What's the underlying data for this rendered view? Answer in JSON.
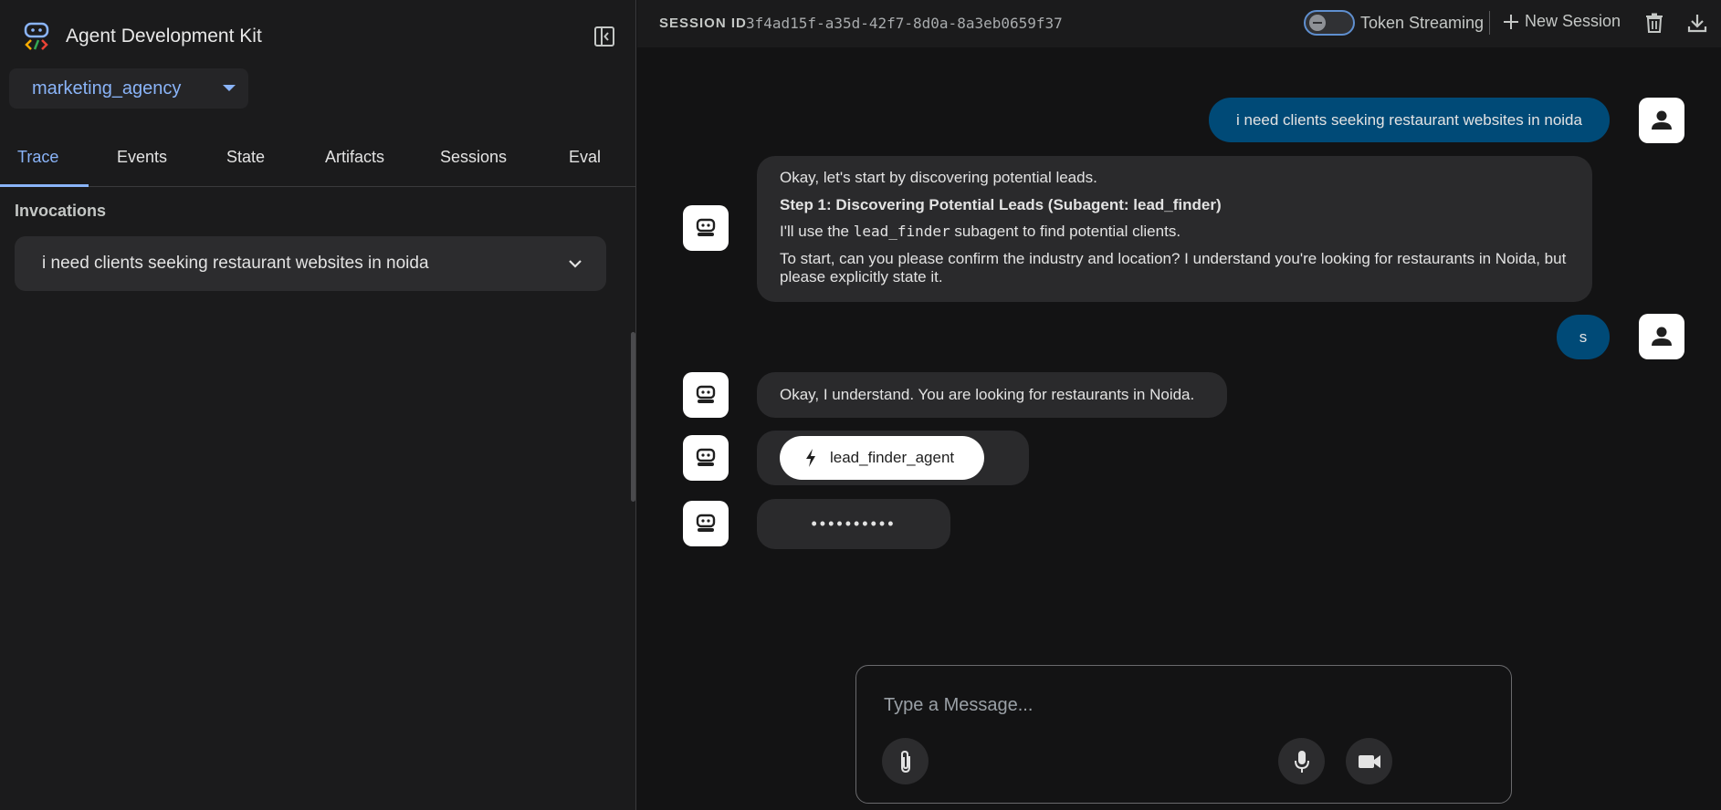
{
  "app": {
    "title": "Agent Development Kit",
    "agent_selected": "marketing_agency"
  },
  "tabs": [
    {
      "label": "Trace"
    },
    {
      "label": "Events"
    },
    {
      "label": "State"
    },
    {
      "label": "Artifacts"
    },
    {
      "label": "Sessions"
    },
    {
      "label": "Eval"
    }
  ],
  "sidebar": {
    "invocations_heading": "Invocations",
    "invocation_item": "i need clients seeking restaurant websites in noida"
  },
  "topbar": {
    "session_label": "SESSION ID",
    "session_id": "3f4ad15f-a35d-42f7-8d0a-8a3eb0659f37",
    "token_streaming_label": "Token Streaming",
    "new_session_label": "New Session"
  },
  "messages": {
    "user_1": "i need clients seeking restaurant websites in noida",
    "bot_1": {
      "line1": "Okay, let's start by discovering potential leads.",
      "step": "Step 1: Discovering Potential Leads (Subagent: lead_finder)",
      "line3_pre": "I'll use the ",
      "line3_code": "lead_finder",
      "line3_post": " subagent to find potential clients.",
      "line4": "To start, can you please confirm the industry and location? I understand you're looking for restaurants in Noida, but please explicitly state it."
    },
    "user_2": "s",
    "bot_2": "Okay, I understand. You are looking for restaurants in Noida.",
    "function_call": "lead_finder_agent",
    "typing_indicator": "••••••••••"
  },
  "composer": {
    "placeholder": "Type a Message..."
  },
  "colors": {
    "accent": "#8ab4f8",
    "user_bubble": "#004a77",
    "bot_bubble": "#2a2a2c"
  }
}
